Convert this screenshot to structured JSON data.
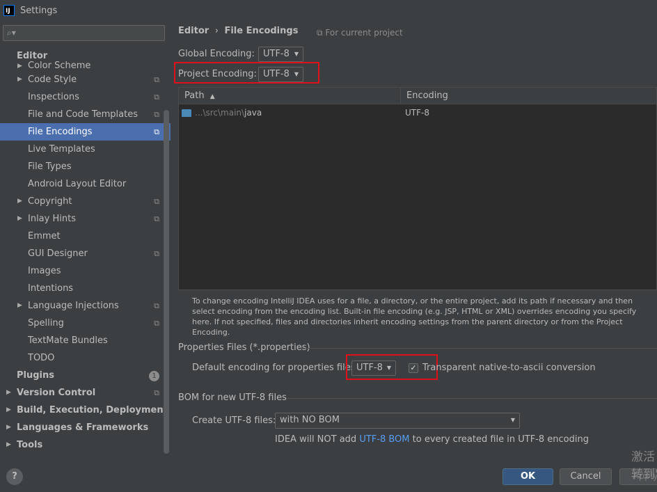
{
  "window": {
    "title": "Settings",
    "logo": "IJ"
  },
  "search": {
    "placeholder": "",
    "icon": "search-icon"
  },
  "sidebar": {
    "items": [
      {
        "label": "Editor",
        "indent": 24,
        "bold": true,
        "arrow": "none"
      },
      {
        "label": "Color Scheme",
        "indent": 40,
        "arrow": "right",
        "partial": true
      },
      {
        "label": "Code Style",
        "indent": 40,
        "arrow": "right",
        "project": true
      },
      {
        "label": "Inspections",
        "indent": 40,
        "project": true
      },
      {
        "label": "File and Code Templates",
        "indent": 40,
        "project": true
      },
      {
        "label": "File Encodings",
        "indent": 40,
        "project": true,
        "selected": true
      },
      {
        "label": "Live Templates",
        "indent": 40
      },
      {
        "label": "File Types",
        "indent": 40
      },
      {
        "label": "Android Layout Editor",
        "indent": 40
      },
      {
        "label": "Copyright",
        "indent": 40,
        "arrow": "right",
        "project": true
      },
      {
        "label": "Inlay Hints",
        "indent": 40,
        "arrow": "right",
        "project": true
      },
      {
        "label": "Emmet",
        "indent": 40
      },
      {
        "label": "GUI Designer",
        "indent": 40,
        "project": true
      },
      {
        "label": "Images",
        "indent": 40
      },
      {
        "label": "Intentions",
        "indent": 40
      },
      {
        "label": "Language Injections",
        "indent": 40,
        "arrow": "right",
        "project": true
      },
      {
        "label": "Spelling",
        "indent": 40,
        "project": true
      },
      {
        "label": "TextMate Bundles",
        "indent": 40
      },
      {
        "label": "TODO",
        "indent": 40
      },
      {
        "label": "Plugins",
        "indent": 24,
        "bold": true,
        "badge": "1"
      },
      {
        "label": "Version Control",
        "indent": 24,
        "bold": true,
        "arrow": "right",
        "project": true
      },
      {
        "label": "Build, Execution, Deployment",
        "indent": 24,
        "bold": true,
        "arrow": "right"
      },
      {
        "label": "Languages & Frameworks",
        "indent": 24,
        "bold": true,
        "arrow": "right"
      },
      {
        "label": "Tools",
        "indent": 24,
        "bold": true,
        "arrow": "right"
      }
    ]
  },
  "breadcrumb": {
    "parent": "Editor",
    "separator": "›",
    "current": "File Encodings"
  },
  "for_current_project": "For current project",
  "global_encoding": {
    "label": "Global Encoding:",
    "value": "UTF-8"
  },
  "project_encoding": {
    "label": "Project Encoding:",
    "value": "UTF-8"
  },
  "table": {
    "headers": {
      "path": "Path",
      "sort_icon": "▲",
      "encoding": "Encoding"
    },
    "rows": [
      {
        "path_prefix": "...\\src\\main\\",
        "path_name": "java",
        "encoding": "UTF-8"
      }
    ]
  },
  "help_text": "To change encoding IntelliJ IDEA uses for a file, a directory, or the entire project, add its path if necessary and then select encoding from the encoding list. Built-in file encoding (e.g. JSP, HTML or XML) overrides encoding you specify here. If not specified, files and directories inherit encoding settings from the parent directory or from the Project Encoding.",
  "properties": {
    "section_title": "Properties Files (*.properties)",
    "default_label": "Default encoding for properties files:",
    "default_value": "UTF-8",
    "transparent_label": "Transparent native-to-ascii conversion",
    "transparent_checked": true
  },
  "bom": {
    "section_title": "BOM for new UTF-8 files",
    "create_label": "Create UTF-8 files:",
    "create_value": "with NO BOM",
    "note_before": "IDEA will NOT add ",
    "note_link": "UTF-8 BOM",
    "note_after": " to every created file in UTF-8 encoding"
  },
  "footer": {
    "help": "?",
    "ok": "OK",
    "cancel": "Cancel",
    "apply": "Apply"
  },
  "watermark": {
    "line1": "激活",
    "line2": "转到\""
  },
  "colors": {
    "accent": "#4b6eaf",
    "highlight": "#e0101a",
    "link": "#589df6"
  }
}
